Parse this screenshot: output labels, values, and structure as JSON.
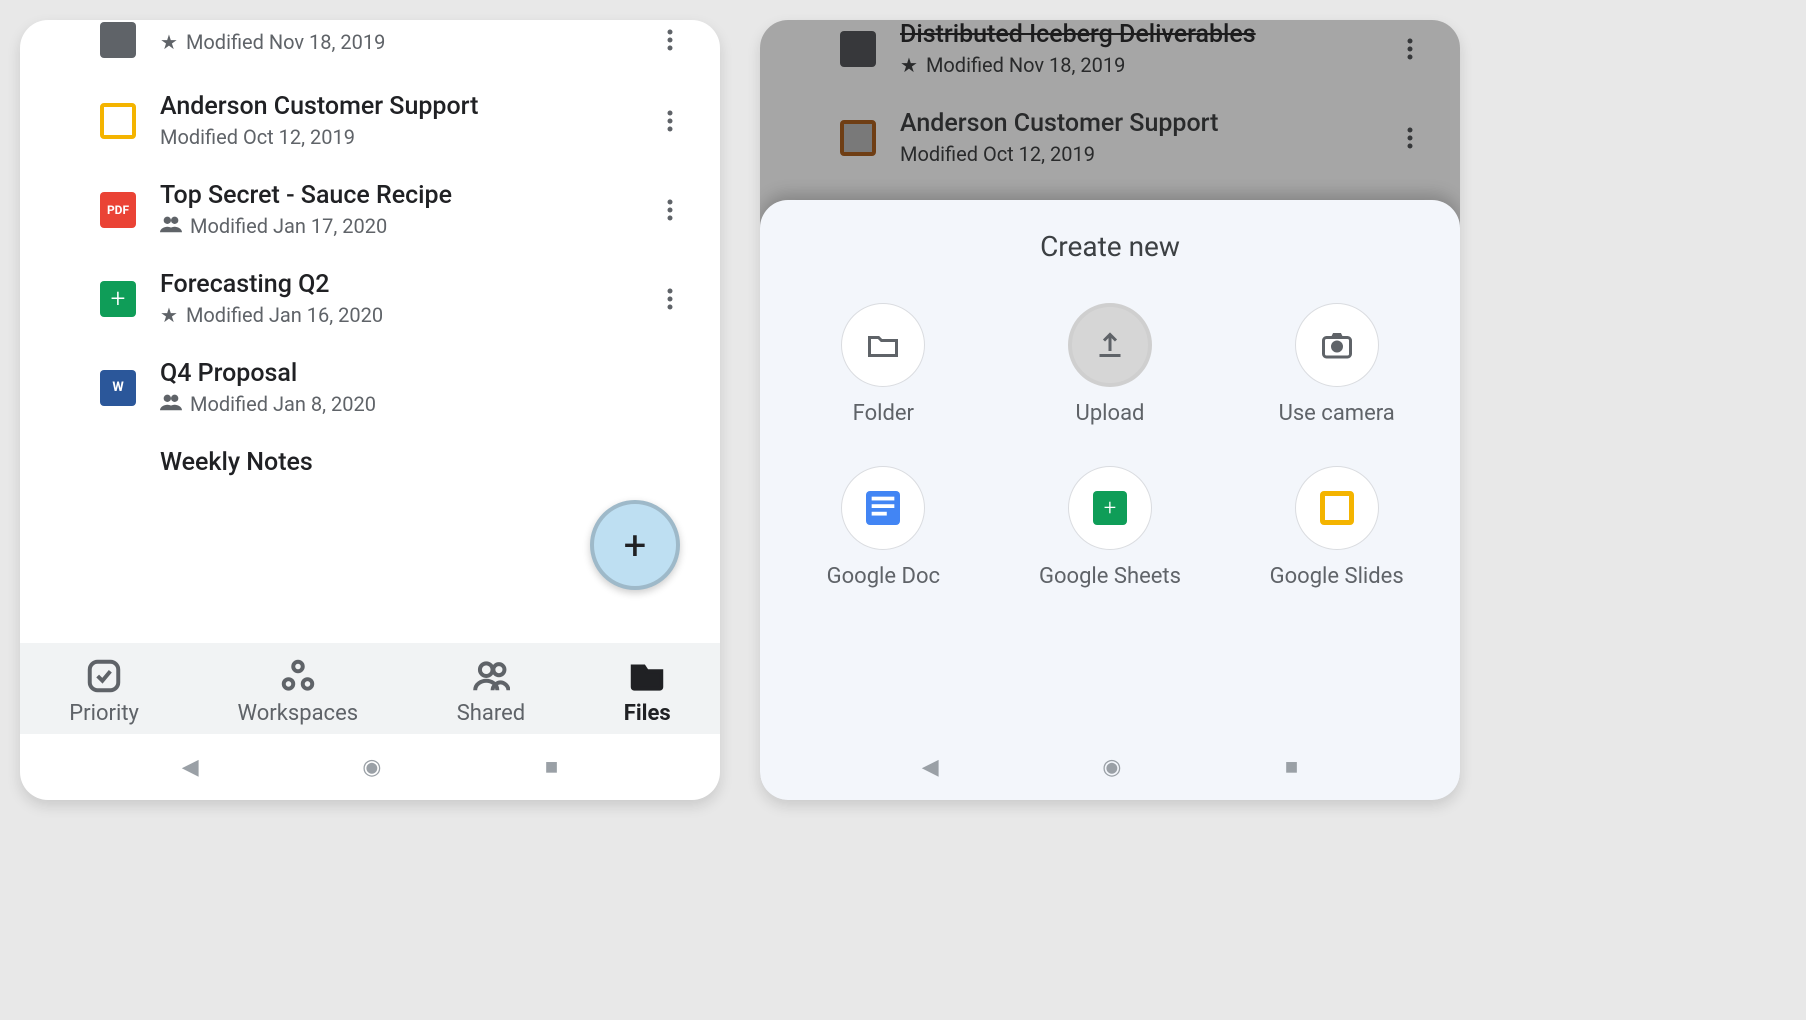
{
  "left": {
    "files": [
      {
        "title": "",
        "meta": "Modified Nov 18, 2019",
        "star": true,
        "type": "folder"
      },
      {
        "title": "Anderson Customer Support",
        "meta": "Modified Oct 12, 2019",
        "type": "slides"
      },
      {
        "title": "Top Secret - Sauce Recipe",
        "meta": "Modified Jan 17, 2020",
        "shared": true,
        "type": "pdf",
        "pdf": "PDF"
      },
      {
        "title": "Forecasting Q2",
        "meta": "Modified Jan 16, 2020",
        "star": true,
        "type": "sheets",
        "plus": "+"
      },
      {
        "title": "Q4 Proposal",
        "meta": "Modified Jan 8, 2020",
        "shared": true,
        "type": "word",
        "letter": "W"
      },
      {
        "title": "Weekly Notes",
        "meta": "",
        "type": "docs"
      }
    ],
    "nav": {
      "priority": "Priority",
      "workspaces": "Workspaces",
      "shared": "Shared",
      "files": "Files"
    }
  },
  "right": {
    "bg": [
      {
        "title": "Distributed Iceberg Deliverables",
        "meta": "Modified Nov 18, 2019",
        "star": true,
        "type": "folder"
      },
      {
        "title": "Anderson Customer Support",
        "meta": "Modified Oct 12, 2019",
        "type": "slides-orange"
      }
    ],
    "sheet": {
      "title": "Create new",
      "items": {
        "folder": "Folder",
        "upload": "Upload",
        "camera": "Use camera",
        "doc": "Google Doc",
        "sheets": "Google Sheets",
        "slides": "Google Slides"
      }
    }
  }
}
